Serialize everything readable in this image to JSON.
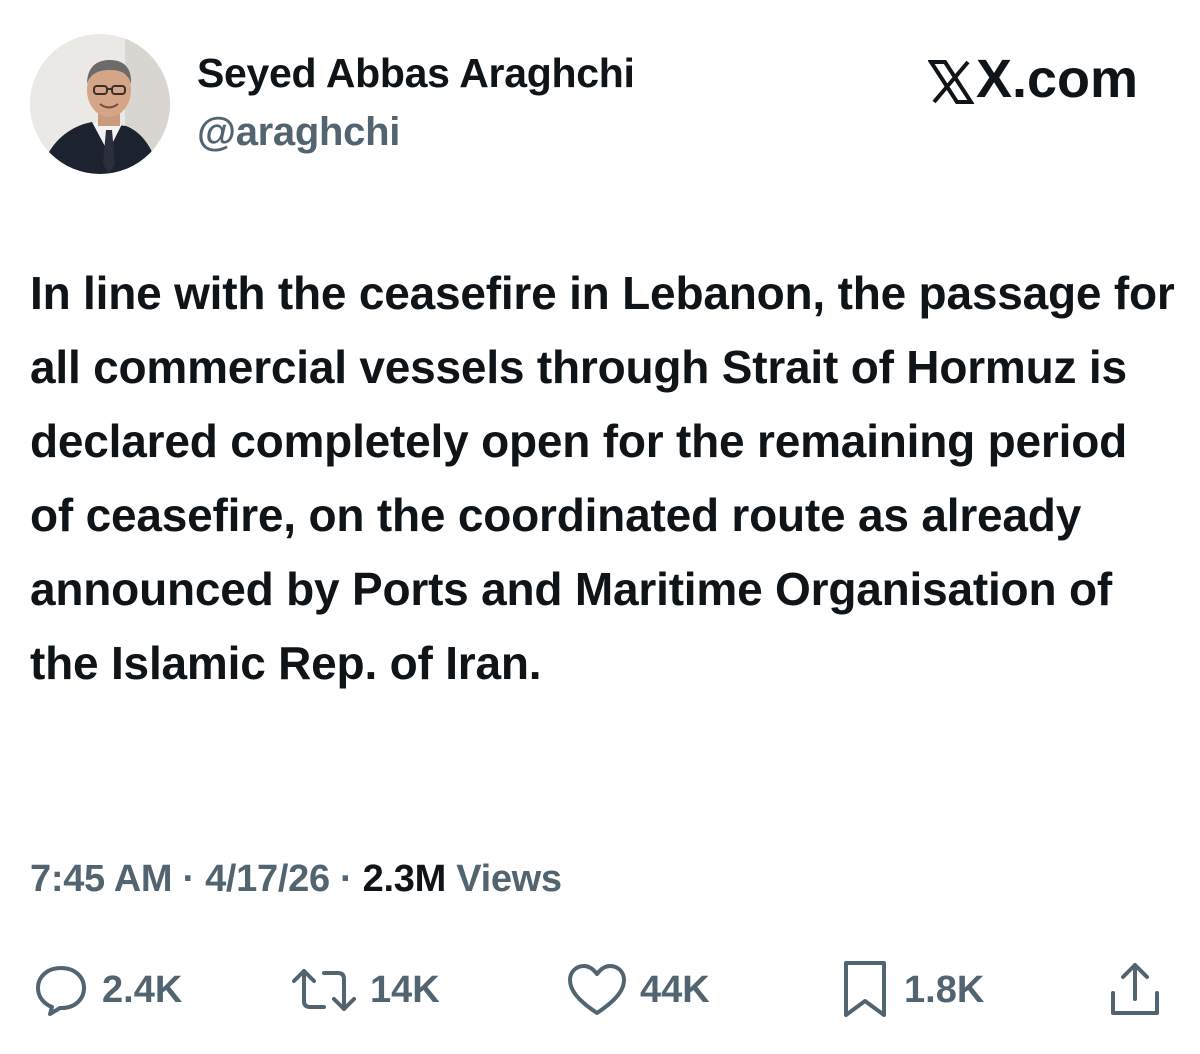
{
  "tweet": {
    "author_name": "Seyed Abbas Araghchi",
    "author_handle": "@araghchi",
    "brand": "X.com",
    "text": "In line with the ceasefire in Lebanon, the passage for all commercial vessels through Strait of Hormuz is declared completely open for the remaining period of ceasefire, on the coordinated route as already announced by Ports and Maritime Organisation of the Islamic Rep. of Iran.",
    "time": "7:45 AM",
    "date": "4/17/26",
    "separator": "·",
    "views_count": "2.3M",
    "views_label": "Views"
  },
  "actions": {
    "replies": "2.4K",
    "reposts": "14K",
    "likes": "44K",
    "bookmarks": "1.8K"
  },
  "icons": {
    "avatar": "avatar-photo",
    "brand": "x-logo-icon",
    "reply": "reply-icon",
    "repost": "repost-icon",
    "like": "heart-icon",
    "bookmark": "bookmark-icon",
    "share": "share-icon"
  },
  "colors": {
    "text_primary": "#0f1419",
    "text_secondary": "#536471",
    "background": "#ffffff"
  }
}
